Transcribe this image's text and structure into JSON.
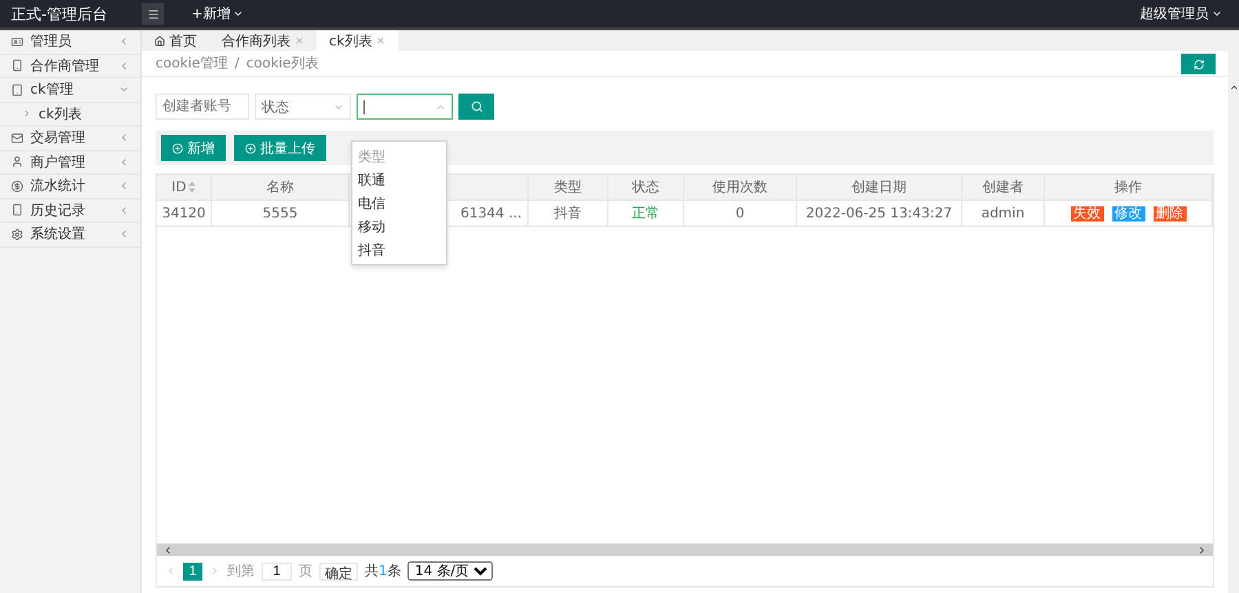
{
  "header": {
    "title": "正式-管理后台",
    "add_menu": "+新增",
    "user": "超级管理员"
  },
  "sidebar": {
    "items": [
      {
        "label": "管理员",
        "expanded": false
      },
      {
        "label": "合作商管理",
        "expanded": false
      },
      {
        "label": "ck管理",
        "expanded": true,
        "children": [
          {
            "label": "ck列表"
          }
        ]
      },
      {
        "label": "交易管理",
        "expanded": false
      },
      {
        "label": "商户管理",
        "expanded": false
      },
      {
        "label": "流水统计",
        "expanded": false
      },
      {
        "label": "历史记录",
        "expanded": false
      },
      {
        "label": "系统设置",
        "expanded": false
      }
    ]
  },
  "tabs": [
    {
      "label": "首页",
      "selected": false,
      "closable": false
    },
    {
      "label": "合作商列表",
      "selected": false,
      "closable": true
    },
    {
      "label": "ck列表",
      "selected": true,
      "closable": true
    }
  ],
  "breadcrumb": {
    "separator": "/",
    "items": [
      "cookie管理",
      "cookie列表"
    ]
  },
  "filters": {
    "account": {
      "placeholder": "创建者账号"
    },
    "status": {
      "placeholder": "状态"
    },
    "type": {
      "open": true,
      "options": [
        {
          "label": "类型",
          "kind": "placeholder"
        },
        {
          "label": "联通",
          "kind": "option"
        },
        {
          "label": "电信",
          "kind": "option"
        },
        {
          "label": "移动",
          "kind": "option"
        },
        {
          "label": "抖音",
          "kind": "option"
        }
      ]
    }
  },
  "toolbar": [
    "新增",
    "批量上传"
  ],
  "table": {
    "columns": [
      "ID",
      "名称",
      "",
      "类型",
      "状态",
      "使用次数",
      "创建日期",
      "创建者",
      "操作"
    ],
    "rows": [
      {
        "cells": [
          "34120",
          "5555",
          "61344 ...",
          "抖音",
          "正常",
          "0",
          "2022-06-25 13:43:27",
          "admin"
        ],
        "actions": [
          {
            "label": "失效",
            "color": "#ff5722"
          },
          {
            "label": "修改",
            "color": "#1e9fff"
          },
          {
            "label": "删除",
            "color": "#ff5722"
          }
        ]
      }
    ]
  },
  "pagination": {
    "pages": [
      {
        "label": "1",
        "selected": true
      }
    ],
    "goto_label": "到第",
    "goto_value": "1",
    "page_unit": "页",
    "confirm": "确定",
    "total_prefix": "共",
    "total_count": "1",
    "total_suffix": "条",
    "page_size": "14 条/页"
  }
}
